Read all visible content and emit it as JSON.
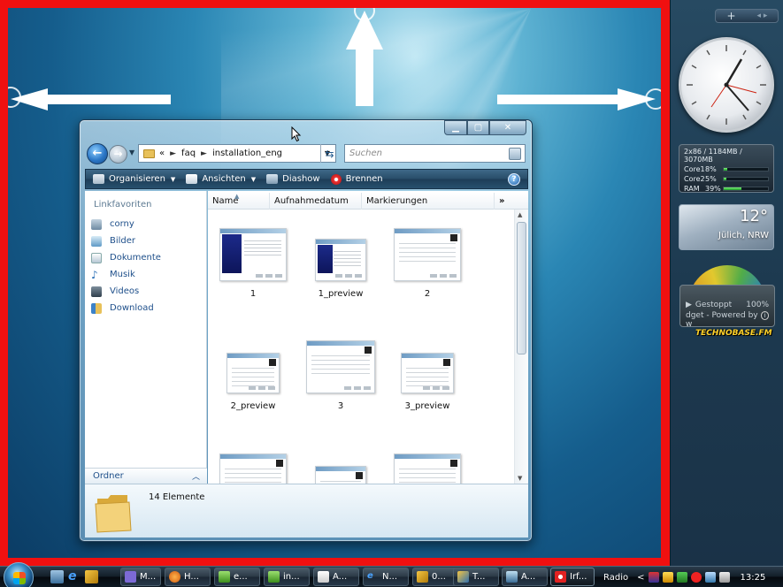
{
  "colors": {
    "frame_red": "#f01010",
    "toolbar_blue": "#284c68",
    "link_blue": "#1e4f8a"
  },
  "sidebar": {
    "add_label": "+",
    "nav_label": "◂ ▸",
    "cpu": {
      "header": "2x86 / 1184MB / 3070MB",
      "rows": [
        {
          "label": "Core1",
          "value": "8%",
          "fraction": 0.08
        },
        {
          "label": "Core2",
          "value": "5%",
          "fraction": 0.05
        },
        {
          "label": "RAM",
          "value": "39%",
          "fraction": 0.39
        }
      ]
    },
    "weather": {
      "temperature": "12°",
      "city": "Jülich, NRW"
    },
    "radio": {
      "status": "Gestoppt",
      "volume": "100%",
      "line2": "dget - Powered by w",
      "info_icon": "i",
      "brand": "TECHNOBASE.FM"
    }
  },
  "window": {
    "address": {
      "overflow": "«",
      "crumbs": [
        "faq",
        "installation_eng"
      ]
    },
    "search_placeholder": "Suchen",
    "toolbar": {
      "organize": "Organisieren",
      "views": "Ansichten",
      "slideshow": "Diashow",
      "burn": "Brennen",
      "help": "?"
    },
    "nav": {
      "header": "Linkfavoriten",
      "items": [
        "corny",
        "Bilder",
        "Dokumente",
        "Musik",
        "Videos",
        "Download"
      ],
      "folders_label": "Ordner"
    },
    "columns": [
      "Name",
      "Aufnahmedatum",
      "Markierungen"
    ],
    "columns_more": "»",
    "files": [
      {
        "name": "1"
      },
      {
        "name": "1_preview"
      },
      {
        "name": "2"
      },
      {
        "name": "2_preview"
      },
      {
        "name": "3"
      },
      {
        "name": "3_preview"
      }
    ],
    "details": {
      "count": "14 Elemente"
    }
  },
  "taskbar": {
    "tasks": [
      "M...",
      "H...",
      "e...",
      "in...",
      "A...",
      "N...",
      "0...",
      "T...",
      "A...",
      "Irf..."
    ],
    "tray": {
      "radio": "Radio",
      "time": "13:25"
    }
  }
}
